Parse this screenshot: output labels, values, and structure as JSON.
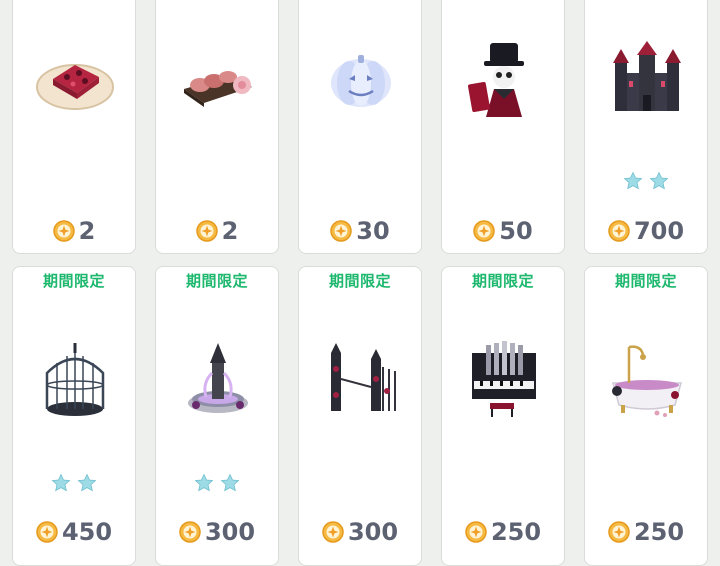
{
  "colors": {
    "limited": "#1db86e",
    "price": "#5d6272",
    "coin": "#f0a028",
    "star": "#8fd6e2"
  },
  "row1": [
    {
      "item": "berry-tart-plate",
      "stars": 0,
      "price": "2"
    },
    {
      "item": "meat-board",
      "stars": 0,
      "price": "2"
    },
    {
      "item": "ghost-pumpkin",
      "stars": 0,
      "price": "30"
    },
    {
      "item": "skeleton-magician",
      "stars": 0,
      "price": "50"
    },
    {
      "item": "dark-castle",
      "stars": 2,
      "price": "700"
    }
  ],
  "row2": [
    {
      "badge": "期間限定",
      "item": "gothic-birdcage",
      "stars": 2,
      "price": "450"
    },
    {
      "badge": "期間限定",
      "item": "gothic-fountain",
      "stars": 2,
      "price": "300"
    },
    {
      "badge": "期間限定",
      "item": "gothic-gate",
      "stars": 0,
      "price": "300"
    },
    {
      "badge": "期間限定",
      "item": "gothic-pipe-organ",
      "stars": 0,
      "price": "250"
    },
    {
      "badge": "期間限定",
      "item": "gothic-bathtub",
      "stars": 0,
      "price": "250"
    }
  ]
}
